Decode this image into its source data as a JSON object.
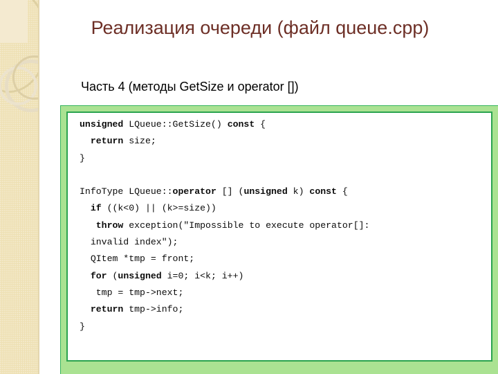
{
  "slide": {
    "title": "Реализация очереди (файл queue.cpp)",
    "subtitle": "Часть 4 (методы GetSize и operator [])",
    "title_color": "#6d2f26",
    "subtitle_color": "#000000",
    "background_color": "#ffffff"
  },
  "sidebar": {
    "name": "decorative-sidebar",
    "background_color": "#eee0b3",
    "accent_color": "#ded0a2"
  },
  "code_panel": {
    "frame_color": "#aae292",
    "border_color": "#2aa34f",
    "background_color": "#ffffff",
    "language": "cpp",
    "lines": [
      [
        {
          "t": "unsigned",
          "b": true
        },
        {
          "t": " LQueue::GetSize() ",
          "b": false
        },
        {
          "t": "const",
          "b": true
        },
        {
          "t": " {",
          "b": false
        }
      ],
      [
        {
          "t": "  ",
          "b": false
        },
        {
          "t": "return",
          "b": true
        },
        {
          "t": " size;",
          "b": false
        }
      ],
      [
        {
          "t": "}",
          "b": false
        }
      ],
      [
        {
          "t": "",
          "b": false
        }
      ],
      [
        {
          "t": "InfoType LQueue::",
          "b": false
        },
        {
          "t": "operator",
          "b": true
        },
        {
          "t": " [] (",
          "b": false
        },
        {
          "t": "unsigned",
          "b": true
        },
        {
          "t": " k) ",
          "b": false
        },
        {
          "t": "const",
          "b": true
        },
        {
          "t": " {",
          "b": false
        }
      ],
      [
        {
          "t": "  ",
          "b": false
        },
        {
          "t": "if",
          "b": true
        },
        {
          "t": " ((k<0) || (k>=size))",
          "b": false
        }
      ],
      [
        {
          "t": "   ",
          "b": false
        },
        {
          "t": "throw",
          "b": true
        },
        {
          "t": " exception(\"Impossible to execute operator[]:",
          "b": false
        }
      ],
      [
        {
          "t": "  invalid index\");",
          "b": false
        }
      ],
      [
        {
          "t": "  QItem *tmp = front;",
          "b": false
        }
      ],
      [
        {
          "t": "  ",
          "b": false
        },
        {
          "t": "for",
          "b": true
        },
        {
          "t": " (",
          "b": false
        },
        {
          "t": "unsigned",
          "b": true
        },
        {
          "t": " i=0; i<k; i++)",
          "b": false
        }
      ],
      [
        {
          "t": "   tmp = tmp->next;",
          "b": false
        }
      ],
      [
        {
          "t": "  ",
          "b": false
        },
        {
          "t": "return",
          "b": true
        },
        {
          "t": " tmp->info;",
          "b": false
        }
      ],
      [
        {
          "t": "}",
          "b": false
        }
      ]
    ]
  }
}
